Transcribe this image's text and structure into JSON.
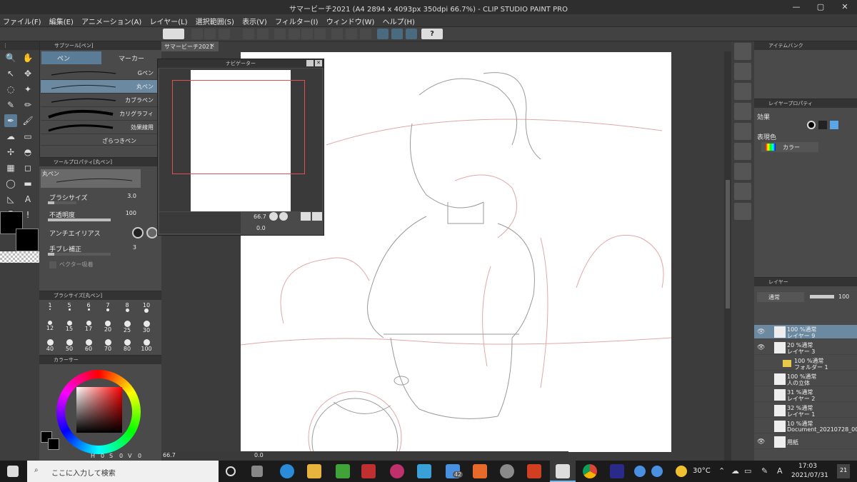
{
  "window": {
    "title": "サマービーチ2021 (A4 2894 x 4093px 350dpi 66.7%) - CLIP STUDIO PAINT PRO",
    "minimize_icon": "minimize-icon",
    "maximize_icon": "maximize-icon",
    "close_icon": "close-icon"
  },
  "menu": [
    "ファイル(F)",
    "編集(E)",
    "アニメーション(A)",
    "レイヤー(L)",
    "選択範囲(S)",
    "表示(V)",
    "フィルター(I)",
    "ウィンドウ(W)",
    "ヘルプ(H)"
  ],
  "canvas_tab": {
    "label": "サマービーチ2021",
    "close": "×"
  },
  "subtool": {
    "header": "サブツール[ペン]",
    "tabs": [
      "ペン",
      "マーカー"
    ],
    "brushes": [
      "Gペン",
      "丸ペン",
      "カブラペン",
      "カリグラフィ",
      "効果線用",
      "ざらつきペン"
    ],
    "selected": "丸ペン"
  },
  "tool_property": {
    "header": "ツールプロパティ[丸ペン]",
    "brush_name": "丸ペン",
    "brush_size_label": "ブラシサイズ",
    "brush_size_value": "3.0",
    "opacity_label": "不透明度",
    "opacity_value": "100",
    "opacity_fraction": 1.0,
    "brush_size_fraction": 0.22,
    "antialias_label": "アンチエイリアス",
    "stabilization_label": "手ブレ補正",
    "stabilization_value": "3",
    "stabilization_fraction": 0.1,
    "vector_label": "ベクター吸着"
  },
  "brush_size_panel": {
    "header": "ブラシサイズ[丸ペン]",
    "sizes": [
      "1",
      "5",
      "6",
      "7",
      "8",
      "10",
      "12",
      "15",
      "17",
      "20",
      "25",
      "30",
      "40",
      "50",
      "60",
      "70",
      "80",
      "100"
    ]
  },
  "color_panel": {
    "header": "カラーサー",
    "h_label": "H",
    "h_value": "0",
    "s_label": "S",
    "s_value": "0",
    "v_label": "V",
    "v_value": "0",
    "main_color": "#000000",
    "sub_color": "#000000"
  },
  "navigator": {
    "title": "ナビゲーター",
    "zoom": "66.7",
    "rotation": "0.0"
  },
  "status_bar": {
    "zoom": "66.7",
    "rotation": "0.0"
  },
  "item_bank": {
    "header": "アイテムバンク"
  },
  "layer_property": {
    "header": "レイヤープロパティ",
    "effect_label": "効果",
    "expression_color_label": "表現色",
    "expression_color_value": "カラー"
  },
  "layer_panel": {
    "header": "レイヤー",
    "blend_mode": "通常",
    "opacity": "100",
    "layers": [
      {
        "line1": "100 %通常",
        "line2": "レイヤー 9",
        "selected": true,
        "visible": true
      },
      {
        "line1": "20 %通常",
        "line2": "レイヤー 3",
        "selected": false,
        "visible": true
      },
      {
        "line1": "100 %通常",
        "line2": "フォルダー 1",
        "selected": false,
        "visible": false,
        "folder": true
      },
      {
        "line1": "100 %通常",
        "line2": "人の立体",
        "selected": false,
        "visible": false
      },
      {
        "line1": "31 %通常",
        "line2": "レイヤー 2",
        "selected": false,
        "visible": false
      },
      {
        "line1": "32 %通常",
        "line2": "レイヤー 1",
        "selected": false,
        "visible": false
      },
      {
        "line1": "10 %通常",
        "line2": "Document_20210728_00",
        "selected": false,
        "visible": false
      },
      {
        "line1": "",
        "line2": "用紙",
        "selected": false,
        "visible": true
      }
    ]
  },
  "taskbar": {
    "search_placeholder": "ここに入力して検索",
    "weather": "30°C",
    "ime": "A",
    "time": "17:03",
    "date": "2021/07/31",
    "notification_count": "21",
    "mail_badge": "42"
  }
}
